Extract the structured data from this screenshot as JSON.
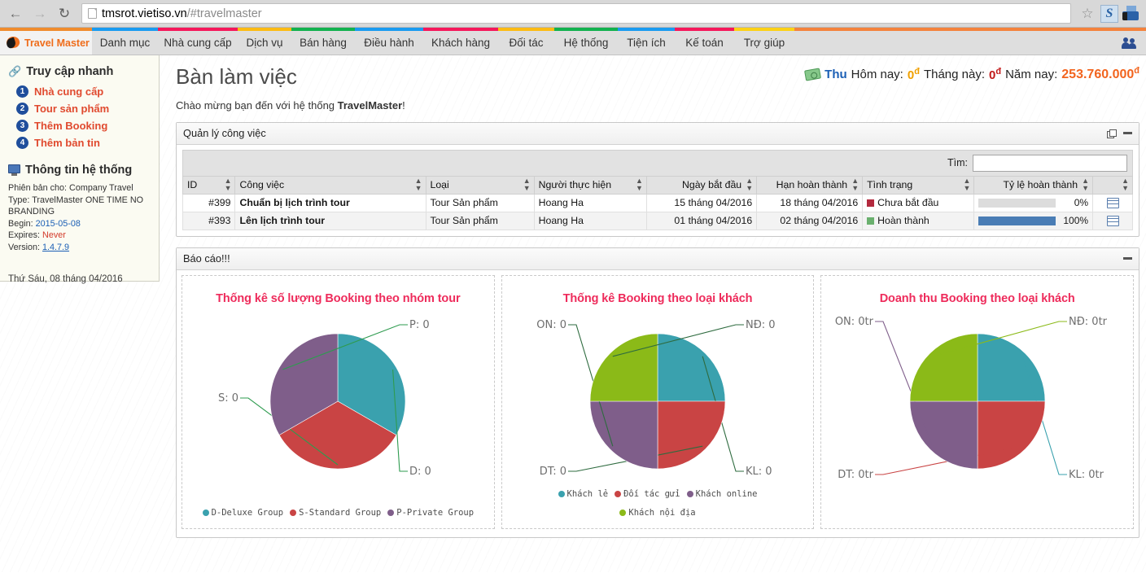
{
  "browser": {
    "back_icon": "back-arrow-icon",
    "forward_icon": "forward-arrow-icon",
    "reload_icon": "reload-icon",
    "url_domain": "tmsrot.vietiso.vn",
    "url_path": "/#travelmaster",
    "star_glyph": "☆",
    "ext_s_label": "S"
  },
  "nav": {
    "brand": "Travel Master",
    "items": [
      {
        "label": "Danh mục",
        "color": "#1a9bf0"
      },
      {
        "label": "Nhà cung cấp",
        "color": "#f5175a"
      },
      {
        "label": "Dịch vụ",
        "color": "#fcbb14"
      },
      {
        "label": "Bán hàng",
        "color": "#12b14e"
      },
      {
        "label": "Điều hành",
        "color": "#1a9bf0"
      },
      {
        "label": "Khách hàng",
        "color": "#f5175a"
      },
      {
        "label": "Đối tác",
        "color": "#fcbb14"
      },
      {
        "label": "Hệ thống",
        "color": "#12b14e"
      },
      {
        "label": "Tiện ích",
        "color": "#1a9bf0"
      },
      {
        "label": "Kế toán",
        "color": "#f5175a"
      },
      {
        "label": "Trợ giúp",
        "color": "#fcd116"
      }
    ],
    "brand_strip_color": "#f08c2e",
    "tail_strip_color": "#f4823c"
  },
  "sidebar": {
    "quick_title": "Truy cập nhanh",
    "quick_items": [
      {
        "num": "1",
        "label": "Nhà cung cấp"
      },
      {
        "num": "2",
        "label": "Tour sản phẩm"
      },
      {
        "num": "3",
        "label": "Thêm Booking"
      },
      {
        "num": "4",
        "label": "Thêm bản tin"
      }
    ],
    "sys_title": "Thông tin hệ thống",
    "sys_company_label": "Phiên bản cho:",
    "sys_company_value": "Company Travel",
    "sys_type_label": "Type:",
    "sys_type_value": "TravelMaster ONE TIME NO BRANDING",
    "sys_begin_label": "Begin:",
    "sys_begin_value": "2015-05-08",
    "sys_expires_label": "Expires:",
    "sys_expires_value": "Never",
    "sys_version_label": "Version:",
    "sys_version_value": "1.4.7.9",
    "date": "Thứ Sáu, 08 tháng 04/2016"
  },
  "main": {
    "page_title": "Bàn làm việc",
    "welcome_prefix": "Chào mừng bạn đến với hệ thống ",
    "welcome_brand": "TravelMaster",
    "welcome_suffix": "!",
    "revenue": {
      "label": "Thu",
      "today_key": "Hôm nay:",
      "today_value": "0",
      "month_key": "Tháng này:",
      "month_value": "0",
      "year_key": "Năm nay:",
      "year_value": "253.760.000",
      "currency": "đ"
    }
  },
  "work_panel": {
    "title": "Quản lý công việc",
    "search_label": "Tìm:",
    "search_value": "",
    "columns": [
      "ID",
      "Công việc",
      "Loại",
      "Người thực hiện",
      "Ngày bắt đầu",
      "Hạn hoàn thành",
      "Tình trạng",
      "Tỷ lệ hoàn thành",
      ""
    ],
    "rows": [
      {
        "id": "#399",
        "task": "Chuẩn bị lịch trình tour",
        "type": "Tour Sản phẩm",
        "assignee": "Hoang Ha",
        "start": "15 tháng 04/2016",
        "due": "18 tháng 04/2016",
        "status": "Chưa bắt đầu",
        "status_color": "#b32a3e",
        "percent": "0%",
        "percent_value": 0
      },
      {
        "id": "#393",
        "task": "Lên lịch trình tour",
        "type": "Tour Sản phẩm",
        "assignee": "Hoang Ha",
        "start": "01 tháng 04/2016",
        "due": "02 tháng 04/2016",
        "status": "Hoàn thành",
        "status_color": "#6ab06e",
        "percent": "100%",
        "percent_value": 100
      }
    ]
  },
  "report_panel": {
    "title": "Báo cáo!!!"
  },
  "chart_data": [
    {
      "type": "pie",
      "title": "Thống kê số lượng Booking theo nhóm tour",
      "categories": [
        "D-Deluxe Group",
        "S-Standard Group",
        "P-Private Group"
      ],
      "values": [
        1,
        1,
        1
      ],
      "colors": [
        "#3aa1ae",
        "#c94444",
        "#7f5e8a"
      ],
      "labels": [
        "D: 0",
        "S: 0",
        "P: 0"
      ],
      "label_values": [
        0,
        0,
        0
      ],
      "legend": [
        "D-Deluxe Group",
        "S-Standard Group",
        "P-Private Group"
      ],
      "legend_position": "bottom",
      "leader_color": "#2e9b4f"
    },
    {
      "type": "pie",
      "title": "Thống kê Booking theo loại khách",
      "categories": [
        "Khách lẻ",
        "Đối tác gửi",
        "Khách online",
        "Khách nội địa"
      ],
      "values": [
        1,
        1,
        1,
        1
      ],
      "colors": [
        "#3aa1ae",
        "#c94444",
        "#7f5e8a",
        "#8bba18"
      ],
      "labels": [
        "KL: 0",
        "DT: 0",
        "ON: 0",
        "NĐ: 0"
      ],
      "label_values": [
        0,
        0,
        0,
        0
      ],
      "legend": [
        "Khách lẻ",
        "Đối tác gửi",
        "Khách online",
        "Khách nội địa"
      ],
      "legend_position": "bottom",
      "leader_color": "#2e6b3f"
    },
    {
      "type": "pie",
      "title": "Doanh thu Booking theo loại khách",
      "categories": [
        "KL",
        "DT",
        "ON",
        "NĐ"
      ],
      "values": [
        1,
        1,
        1,
        1
      ],
      "colors": [
        "#3aa1ae",
        "#c94444",
        "#7f5e8a",
        "#8bba18"
      ],
      "labels": [
        "KL: 0tr",
        "DT: 0tr",
        "ON: 0tr",
        "NĐ: 0tr"
      ],
      "label_values": [
        0,
        0,
        0,
        0
      ],
      "legend": [],
      "legend_position": "none",
      "leader_color": "match-slice"
    }
  ]
}
